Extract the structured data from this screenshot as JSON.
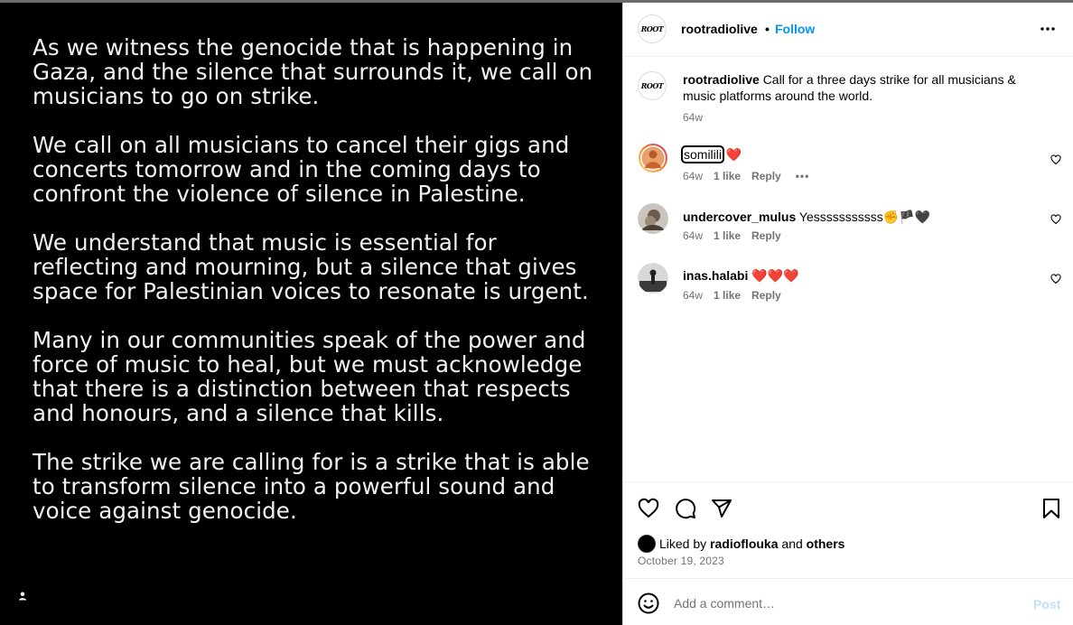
{
  "media": {
    "paragraphs": [
      "As we witness the genocide that is happening in Gaza, and the silence that surrounds it, we call on musicians to go on strike.",
      "We call on all musicians to cancel their gigs and concerts tomorrow and in the coming days to confront the violence of silence in Palestine.",
      "We understand that music is essential for reflecting and mourning, but a silence that gives space for Palestinian voices to resonate is urgent.",
      "Many in our communities speak of the power and force of music to heal, but we must acknowledge that there is a distinction between that respects and honours, and a silence that kills.",
      "The strike we are calling for is a strike that is able to transform silence into a powerful sound and voice against genocide."
    ],
    "tag_icon": "user-tag-icon"
  },
  "header": {
    "avatar_text": "ROOT",
    "username": "rootradiolive",
    "separator": "•",
    "follow_label": "Follow",
    "more_icon": "more-horizontal-icon"
  },
  "caption": {
    "username": "rootradiolive",
    "text": "Call for a three days strike for all musicians & music platforms around the world.",
    "time": "64w"
  },
  "comments": [
    {
      "username": "somilili",
      "text": "❤️",
      "time": "64w",
      "likes": "1 like",
      "reply": "Reply",
      "more": "•••"
    },
    {
      "username": "undercover_mulus",
      "text": "Yesssssssssss✊🏴🖤",
      "time": "64w",
      "likes": "1 like",
      "reply": "Reply"
    },
    {
      "username": "inas.halabi",
      "text": "❤️❤️❤️",
      "time": "64w",
      "likes": "1 like",
      "reply": "Reply"
    }
  ],
  "actions": {
    "icons": [
      "heart-icon",
      "comment-icon",
      "share-icon",
      "bookmark-icon"
    ],
    "liked_prefix": "Liked by",
    "liked_user": "radioflouka",
    "liked_and": "and",
    "liked_others": "others",
    "date": "October 19, 2023"
  },
  "add_comment": {
    "placeholder": "Add a comment…",
    "post_label": "Post",
    "emoji_icon": "emoji-icon"
  },
  "colors": {
    "accent": "#0095f6",
    "muted": "#737373",
    "post_disabled": "#c0dffd"
  }
}
